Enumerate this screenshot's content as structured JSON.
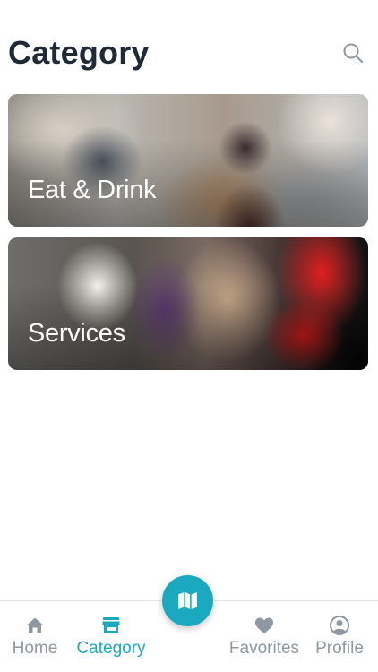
{
  "header": {
    "title": "Category",
    "search_icon": "search-icon"
  },
  "categories": [
    {
      "label": "Eat & Drink"
    },
    {
      "label": "Services"
    }
  ],
  "tabbar": {
    "items": [
      {
        "label": "Home",
        "icon": "home-icon",
        "active": false
      },
      {
        "label": "Category",
        "icon": "store-icon",
        "active": true
      },
      {
        "label": "Favorites",
        "icon": "heart-icon",
        "active": false
      },
      {
        "label": "Profile",
        "icon": "user-circle-icon",
        "active": false
      }
    ],
    "fab_icon": "map-icon"
  },
  "colors": {
    "accent": "#1aa9bf",
    "inactive": "#8f98a1",
    "title": "#1f2a36"
  }
}
